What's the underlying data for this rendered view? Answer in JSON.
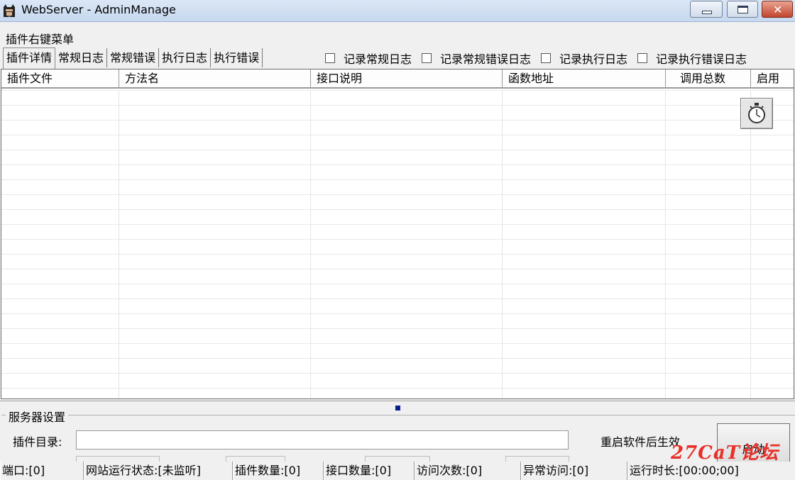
{
  "window": {
    "title": "WebServer - AdminManage"
  },
  "menu_label": "插件右键菜单",
  "tabs": [
    {
      "label": "插件详情",
      "active": true
    },
    {
      "label": "常规日志",
      "active": false
    },
    {
      "label": "常规错误",
      "active": false
    },
    {
      "label": "执行日志",
      "active": false
    },
    {
      "label": "执行错误",
      "active": false
    }
  ],
  "checkboxes": [
    {
      "label": "记录常规日志",
      "checked": false
    },
    {
      "label": "记录常规错误日志",
      "checked": false
    },
    {
      "label": "记录执行日志",
      "checked": false
    },
    {
      "label": "记录执行错误日志",
      "checked": false
    }
  ],
  "table": {
    "columns": [
      "插件文件",
      "方法名",
      "接口说明",
      "函数地址",
      "调用总数",
      "启用"
    ],
    "rows": []
  },
  "server_settings": {
    "title": "服务器设置",
    "plugin_dir_label": "插件目录:",
    "plugin_dir_value": "",
    "restart_note": "重启软件后生效",
    "start_button": "启动"
  },
  "statusbar": [
    "端口:[0]",
    "网站运行状态:[未监听]",
    "插件数量:[0]",
    "接口数量:[0]",
    "访问次数:[0]",
    "异常访问:[0]",
    "运行时长:[00:00;00]"
  ],
  "watermark": "27CaT论坛",
  "colors": {
    "titlebar": "#c6d8ef",
    "close_button": "#c2452d",
    "watermark": "#e8302a"
  },
  "icons": {
    "app": "batman-icon",
    "timer": "stopwatch-icon"
  }
}
